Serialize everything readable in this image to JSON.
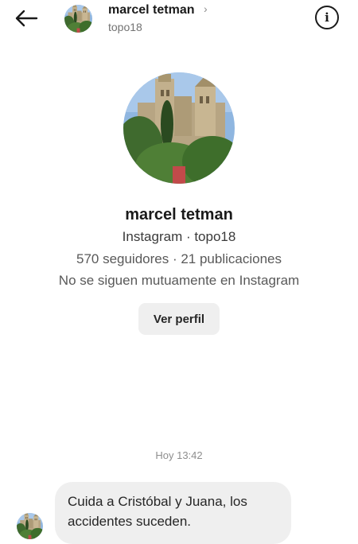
{
  "header": {
    "name": "marcel tetman",
    "chevron": "›",
    "username": "topo18",
    "info_icon": "i"
  },
  "profile": {
    "name": "marcel tetman",
    "platform_line": "Instagram · topo18",
    "stats_line": "570 seguidores · 21 publicaciones",
    "mutual_line": "No se siguen mutuamente en Instagram",
    "view_profile_label": "Ver perfil"
  },
  "thread": {
    "timestamp": "Hoy 13:42",
    "messages": [
      {
        "text": "Cuida a Cristóbal y Juana, los accidentes suceden."
      }
    ]
  },
  "icons": [
    "back-arrow-icon",
    "info-icon",
    "chevron-right-icon"
  ],
  "colors": {
    "bubble": "#efefef",
    "button": "#efefef",
    "text": "#262626",
    "secondary": "#737373"
  }
}
